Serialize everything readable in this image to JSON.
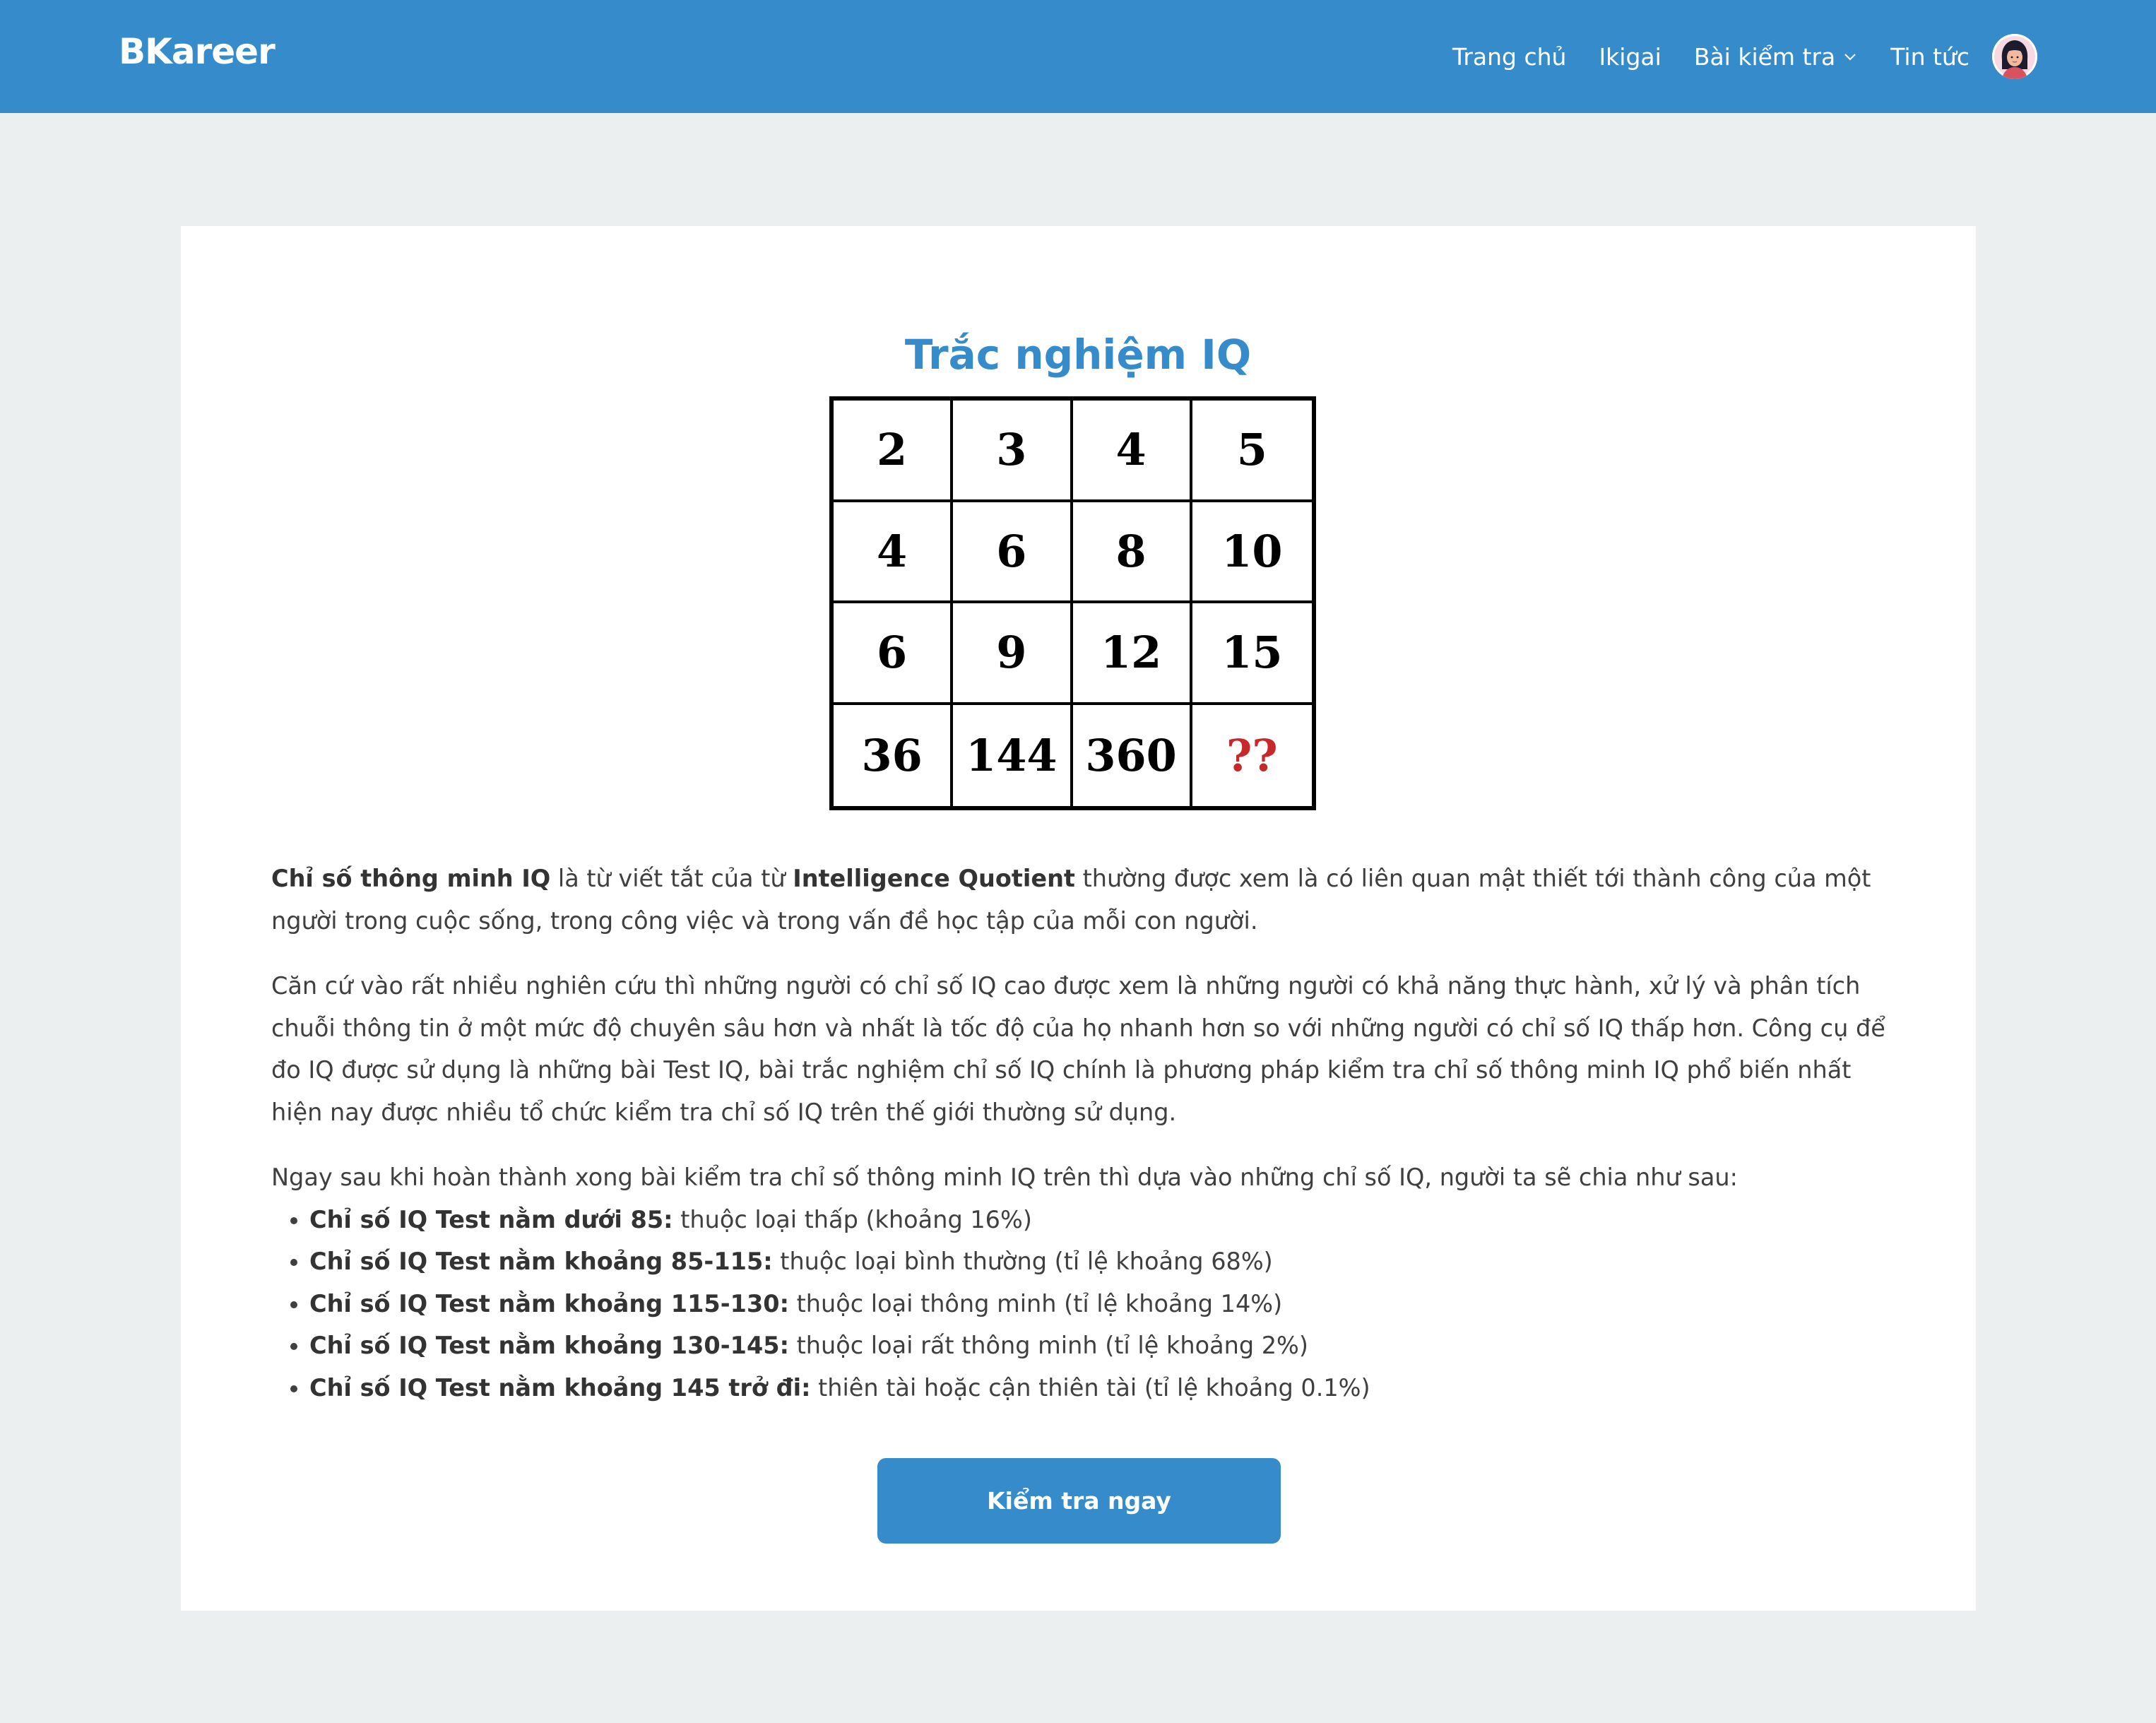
{
  "header": {
    "brand": "BKareer",
    "nav": {
      "home": "Trang chủ",
      "ikigai": "Ikigai",
      "tests": "Bài kiểm tra",
      "news": "Tin tức"
    }
  },
  "main": {
    "title": "Trắc nghiệm IQ",
    "puzzle": [
      [
        "2",
        "3",
        "4",
        "5"
      ],
      [
        "4",
        "6",
        "8",
        "10"
      ],
      [
        "6",
        "9",
        "12",
        "15"
      ],
      [
        "36",
        "144",
        "360",
        "??"
      ]
    ],
    "intro": {
      "bold1": "Chỉ số thông minh IQ",
      "text1": " là từ viết tắt của từ ",
      "bold2": "Intelligence Quotient",
      "text2": " thường được xem là có liên quan mật thiết tới thành công của một người trong cuộc sống, trong công việc và trong vấn đề học tập của mỗi con người."
    },
    "paragraph2": "Căn cứ vào rất nhiều nghiên cứu thì những người có chỉ số IQ cao được xem là những người có khả năng thực hành, xử lý và phân tích chuỗi thông tin ở một mức độ chuyên sâu hơn và nhất là tốc độ của họ nhanh hơn so với những người có chỉ số IQ thấp hơn. Công cụ để đo IQ được sử dụng là những bài Test IQ, bài trắc nghiệm chỉ số IQ chính là phương pháp kiểm tra chỉ số thông minh IQ phổ biến nhất hiện nay được nhiều tổ chức kiểm tra chỉ số IQ trên thế giới thường sử dụng.",
    "list_intro": "Ngay sau khi hoàn thành xong bài kiểm tra chỉ số thông minh IQ trên thì dựa vào những chỉ số IQ, người ta sẽ chia như sau:",
    "levels": [
      {
        "label": "Chỉ số IQ Test nằm dưới 85:",
        "desc": " thuộc loại thấp (khoảng 16%)"
      },
      {
        "label": "Chỉ số IQ Test nằm khoảng 85-115:",
        "desc": " thuộc loại bình thường (tỉ lệ khoảng 68%)"
      },
      {
        "label": "Chỉ số IQ Test nằm khoảng 115-130:",
        "desc": " thuộc loại thông minh (tỉ lệ khoảng 14%)"
      },
      {
        "label": "Chỉ số IQ Test nằm khoảng 130-145:",
        "desc": " thuộc loại rất thông minh (tỉ lệ khoảng 2%)"
      },
      {
        "label": "Chỉ số IQ Test nằm khoảng 145 trở đi:",
        "desc": " thiên tài hoặc cận thiên tài (tỉ lệ khoảng 0.1%)"
      }
    ],
    "cta": "Kiểm tra ngay"
  },
  "colors": {
    "brand": "#368ccb",
    "background": "#ebefef",
    "question_mark": "#c8282a"
  }
}
